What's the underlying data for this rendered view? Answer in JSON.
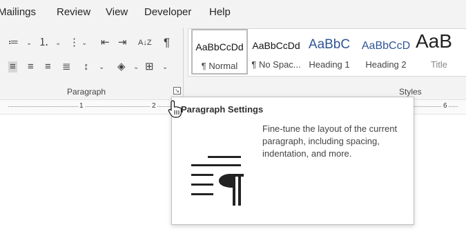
{
  "tabs": [
    "Mailings",
    "Review",
    "View",
    "Developer",
    "Help"
  ],
  "groups": {
    "paragraph": "Paragraph",
    "styles": "Styles"
  },
  "styles": [
    {
      "sample": "AaBbCcDd",
      "name": "¶ Normal"
    },
    {
      "sample": "AaBbCcDd",
      "name": "¶ No Spac..."
    },
    {
      "sample": "AaBbC",
      "name": "Heading 1"
    },
    {
      "sample": "AaBbCcD",
      "name": "Heading 2"
    },
    {
      "sample": "AaB",
      "name": "Title"
    }
  ],
  "ruler": [
    "1",
    "2",
    "6"
  ],
  "tooltip": {
    "title": "Paragraph Settings",
    "description": "Fine-tune the layout of the current paragraph, including spacing, indentation, and more."
  },
  "icons": {
    "bullets": "≔",
    "numbering": "⒈",
    "multilevel": "⋮",
    "decrease_indent": "⇤",
    "increase_indent": "⇥",
    "sort": "A↓Z",
    "show_marks": "¶",
    "align_left": "≡",
    "center": "≡",
    "align_right": "≡",
    "justify": "≣",
    "line_spacing": "↕",
    "shading": "◈",
    "borders": "⊞",
    "launcher": "↘"
  },
  "colors": {
    "heading": "#2f5496",
    "ribbon_bg": "#f3f3f3"
  }
}
